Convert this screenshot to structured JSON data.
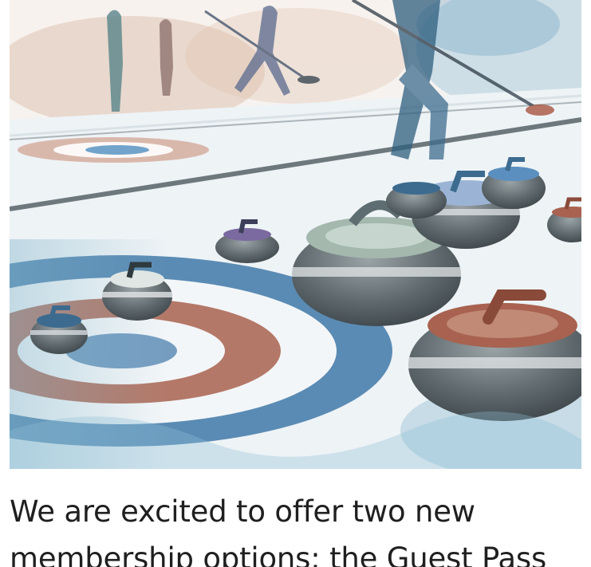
{
  "article": {
    "paragraph_lines": [
      "We are excited to offer two new",
      "membership options: the Guest Pass"
    ]
  },
  "hero_image": {
    "subject": "watercolor-curling-illustration",
    "colors": {
      "ice": "#eef3f6",
      "house_blue": "#3f78a8",
      "house_red": "#a8624f",
      "stone_grey": "#5f6a6e",
      "handle_red": "#8a4a3a",
      "handle_blue": "#3c6b8f"
    }
  }
}
